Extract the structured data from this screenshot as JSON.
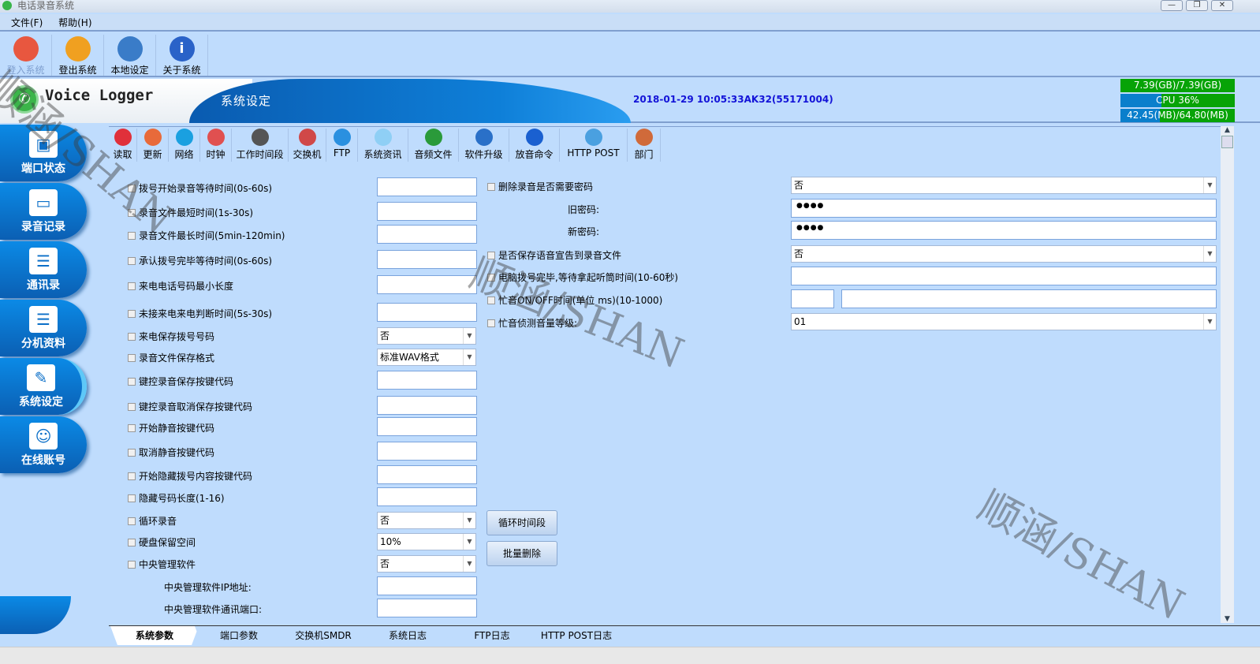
{
  "window": {
    "title": "电话录音系统",
    "controls": [
      "—",
      "❐",
      "✕"
    ]
  },
  "menu": [
    "文件(F)",
    "帮助(H)"
  ],
  "toolbar": [
    {
      "label": "登入系统",
      "icon": "login-icon",
      "color": "#e8573f",
      "disabled": true
    },
    {
      "label": "登出系统",
      "icon": "logout-icon",
      "color": "#f0a020"
    },
    {
      "label": "本地设定",
      "icon": "tools-icon",
      "color": "#3a7cc8"
    },
    {
      "label": "关于系统",
      "icon": "info-icon",
      "color": "#2a62c8"
    }
  ],
  "banner": {
    "brand": "Voice Logger",
    "section": "系统设定",
    "datetime": "2018-01-29 10:05:33AK32(55171004)"
  },
  "stats": {
    "disk": "7.39(GB)/7.39(GB)",
    "cpu": "CPU 36%",
    "cpu_percent": 36,
    "memory": "42.45(MB)/64.80(MB)",
    "memory_percent": 65.5
  },
  "nav": [
    {
      "label": "端口状态",
      "icon": "port-status-icon"
    },
    {
      "label": "录音记录",
      "icon": "recording-icon"
    },
    {
      "label": "通讯录",
      "icon": "contacts-icon"
    },
    {
      "label": "分机资料",
      "icon": "extension-icon"
    },
    {
      "label": "系统设定",
      "icon": "wrench-icon",
      "active": true
    },
    {
      "label": "在线账号",
      "icon": "users-icon"
    }
  ],
  "subtoolbar": [
    {
      "label": "读取",
      "icon": "read-icon",
      "color": "#e0303a"
    },
    {
      "label": "更新",
      "icon": "update-icon",
      "color": "#e86a3a"
    },
    {
      "label": "网络",
      "icon": "network-icon",
      "color": "#1aa0e0"
    },
    {
      "label": "时钟",
      "icon": "clock-icon",
      "color": "#e05050"
    },
    {
      "label": "工作时间段",
      "icon": "calendar-icon",
      "color": "#555"
    },
    {
      "label": "交换机",
      "icon": "phone-icon",
      "color": "#d04848"
    },
    {
      "label": "FTP",
      "icon": "ftp-icon",
      "color": "#2a90e0"
    },
    {
      "label": "系统资讯",
      "icon": "info-icon",
      "color": "#8fcff5"
    },
    {
      "label": "音频文件",
      "icon": "audio-file-icon",
      "color": "#2a9a3a"
    },
    {
      "label": "软件升级",
      "icon": "upgrade-icon",
      "color": "#2a70c8"
    },
    {
      "label": "放音命令",
      "icon": "play-icon",
      "color": "#1a60d0"
    },
    {
      "label": "HTTP POST",
      "icon": "http-icon",
      "color": "#4aa0e0"
    },
    {
      "label": "部门",
      "icon": "department-icon",
      "color": "#d06a3a"
    }
  ],
  "left_settings": [
    {
      "label": "拨号开始录音等待时间(0s-60s)",
      "type": "input",
      "value": ""
    },
    {
      "label": "录音文件最短时间(1s-30s)",
      "type": "input",
      "value": ""
    },
    {
      "label": "录音文件最长时间(5min-120min)",
      "type": "input",
      "value": ""
    },
    {
      "label": "承认拨号完毕等待时间(0s-60s)",
      "type": "input",
      "value": ""
    },
    {
      "label": "来电电话号码最小长度",
      "type": "input",
      "value": ""
    },
    {
      "label": "未接来电来电判断时间(5s-30s)",
      "type": "input",
      "value": ""
    },
    {
      "label": "来电保存拨号号码",
      "type": "select",
      "value": "否"
    },
    {
      "label": "录音文件保存格式",
      "type": "select",
      "value": "标准WAV格式"
    },
    {
      "label": "键控录音保存按键代码",
      "type": "input",
      "value": ""
    },
    {
      "label": "键控录音取消保存按键代码",
      "type": "input",
      "value": ""
    },
    {
      "label": "开始静音按键代码",
      "type": "input",
      "value": ""
    },
    {
      "label": "取消静音按键代码",
      "type": "input",
      "value": ""
    },
    {
      "label": "开始隐藏拨号内容按键代码",
      "type": "input",
      "value": ""
    },
    {
      "label": "隐藏号码长度(1-16)",
      "type": "input",
      "value": ""
    },
    {
      "label": "循环录音",
      "type": "select",
      "value": "否"
    },
    {
      "label": "硬盘保留空间",
      "type": "select",
      "value": "10%"
    },
    {
      "label": "中央管理软件",
      "type": "select",
      "value": "否"
    },
    {
      "label": "中央管理软件IP地址:",
      "type": "input",
      "value": "",
      "nocheck": true
    },
    {
      "label": "中央管理软件通讯端口:",
      "type": "input",
      "value": "",
      "nocheck": true
    }
  ],
  "right_settings": [
    {
      "label": "删除录音是否需要密码",
      "type": "select",
      "value": "否"
    },
    {
      "label": "旧密码:",
      "type": "password",
      "value": "●●●●",
      "nocheck": true
    },
    {
      "label": "新密码:",
      "type": "password",
      "value": "●●●●",
      "nocheck": true
    },
    {
      "label": "是否保存语音宣告到录音文件",
      "type": "select",
      "value": "否"
    },
    {
      "label": "电脑拨号完毕,等待拿起听筒时间(10-60秒)",
      "type": "input",
      "value": ""
    },
    {
      "label": "忙音ON/OFF时间(单位 ms)(10-1000)",
      "type": "split",
      "value": ""
    },
    {
      "label": "忙音侦测音量等级:",
      "type": "select",
      "value": "01"
    }
  ],
  "buttons": {
    "loop_period": "循环时间段",
    "batch_delete": "批量删除"
  },
  "tabs": [
    "系统参数",
    "端口参数",
    "交换机SMDR",
    "系统日志",
    "FTP日志",
    "HTTP POST日志"
  ],
  "watermark": "顺涵/SHAN"
}
